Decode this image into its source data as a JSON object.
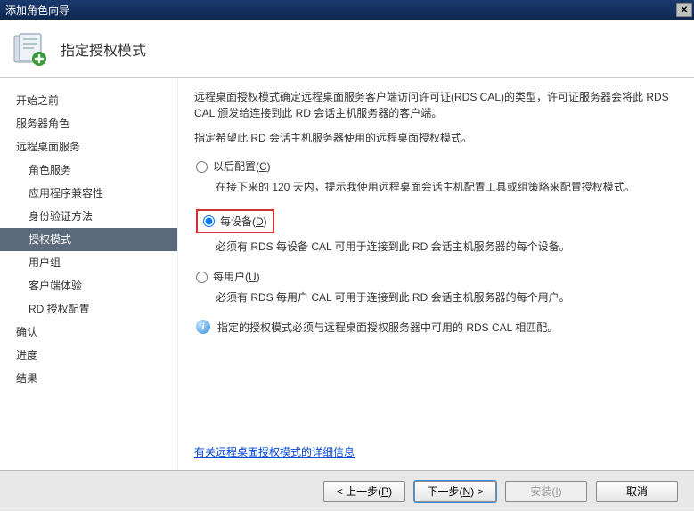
{
  "window": {
    "title": "添加角色向导",
    "close": "✕"
  },
  "header": {
    "title": "指定授权模式"
  },
  "sidebar": {
    "items": [
      {
        "label": "开始之前",
        "sub": false
      },
      {
        "label": "服务器角色",
        "sub": false
      },
      {
        "label": "远程桌面服务",
        "sub": false
      },
      {
        "label": "角色服务",
        "sub": true
      },
      {
        "label": "应用程序兼容性",
        "sub": true
      },
      {
        "label": "身份验证方法",
        "sub": true
      },
      {
        "label": "授权模式",
        "sub": true,
        "selected": true
      },
      {
        "label": "用户组",
        "sub": true
      },
      {
        "label": "客户端体验",
        "sub": true
      },
      {
        "label": "RD 授权配置",
        "sub": true
      },
      {
        "label": "确认",
        "sub": false
      },
      {
        "label": "进度",
        "sub": false
      },
      {
        "label": "结果",
        "sub": false
      }
    ]
  },
  "content": {
    "desc1": "远程桌面授权模式确定远程桌面服务客户端访问许可证(RDS CAL)的类型，许可证服务器会将此 RDS CAL 颁发给连接到此 RD 会话主机服务器的客户端。",
    "desc2": "指定希望此 RD 会话主机服务器使用的远程桌面授权模式。",
    "options": {
      "later": {
        "label_pre": "以后配置(",
        "hotkey": "C",
        "label_post": ")",
        "sub": "在接下来的 120 天内，提示我使用远程桌面会话主机配置工具或组策略来配置授权模式。"
      },
      "device": {
        "label_pre": "每设备(",
        "hotkey": "D",
        "label_post": ")",
        "sub": "必须有 RDS 每设备 CAL 可用于连接到此 RD 会话主机服务器的每个设备。"
      },
      "user": {
        "label_pre": "每用户(",
        "hotkey": "U",
        "label_post": ")",
        "sub": "必须有 RDS 每用户 CAL 可用于连接到此 RD 会话主机服务器的每个用户。"
      }
    },
    "info_text": "指定的授权模式必须与远程桌面授权服务器中可用的 RDS CAL 相匹配。",
    "link_text": "有关远程桌面授权模式的详细信息"
  },
  "footer": {
    "back_pre": "< 上一步(",
    "back_key": "P",
    "back_post": ")",
    "next_pre": "下一步(",
    "next_key": "N",
    "next_post": ") >",
    "install_pre": "安装(",
    "install_key": "I",
    "install_post": ")",
    "cancel": "取消"
  }
}
